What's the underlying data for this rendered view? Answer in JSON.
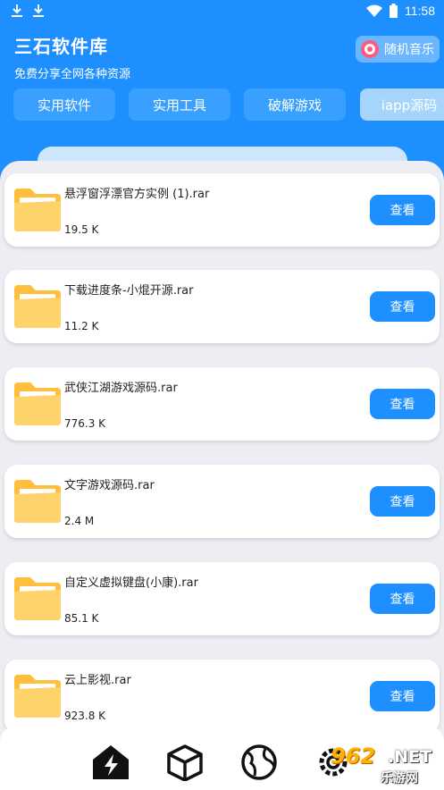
{
  "status_bar": {
    "time": "11:58",
    "icons": [
      "download-icon",
      "download-icon",
      "wifi-icon",
      "battery-icon"
    ]
  },
  "header": {
    "title": "三石软件库",
    "subtitle": "免费分享全网各种资源",
    "music_button": {
      "label": "随机音乐",
      "icon": "music-icon"
    }
  },
  "tabs": [
    {
      "label": "实用软件",
      "active": false
    },
    {
      "label": "实用工具",
      "active": false
    },
    {
      "label": "破解游戏",
      "active": false
    },
    {
      "label": "iapp源码",
      "active": true
    }
  ],
  "files": [
    {
      "name": "悬浮窗浮漂官方实例 (1).rar",
      "size": "19.5 K",
      "action": "查看",
      "icon": "folder-icon"
    },
    {
      "name": "下载进度条-小焜开源.rar",
      "size": "11.2 K",
      "action": "查看",
      "icon": "folder-icon"
    },
    {
      "name": "武侠江湖游戏源码.rar",
      "size": "776.3 K",
      "action": "查看",
      "icon": "folder-icon"
    },
    {
      "name": "文字游戏源码.rar",
      "size": "2.4 M",
      "action": "查看",
      "icon": "folder-icon"
    },
    {
      "name": "自定义虚拟键盘(小康).rar",
      "size": "85.1 K",
      "action": "查看",
      "icon": "folder-icon"
    },
    {
      "name": "云上影视.rar",
      "size": "923.8 K",
      "action": "查看",
      "icon": "folder-icon"
    }
  ],
  "bottom_nav": [
    {
      "icon": "home-lightning-icon",
      "active": true
    },
    {
      "icon": "cube-icon",
      "active": false
    },
    {
      "icon": "globe-icon",
      "active": false
    },
    {
      "icon": "settings-icon",
      "active": false
    }
  ],
  "watermark": {
    "main": "962",
    "suffix": ".NET",
    "sub": "乐游网"
  },
  "colors": {
    "primary": "#1e8fff",
    "background": "#eceef3",
    "folder": "#ffc84a"
  }
}
